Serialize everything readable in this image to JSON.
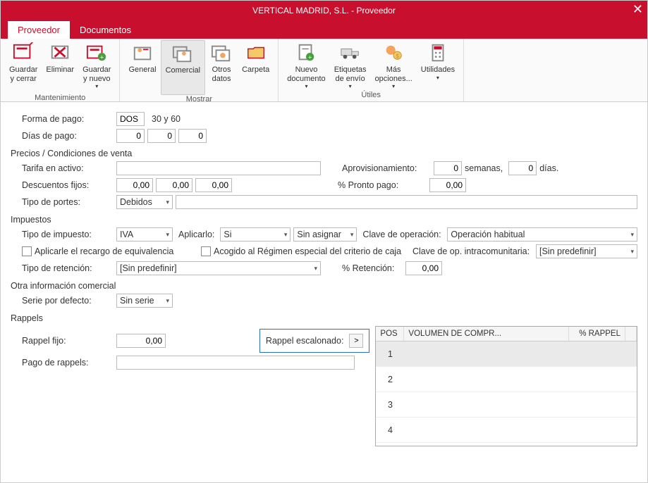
{
  "title": "VERTICAL MADRID, S.L. - Proveedor",
  "tabs": {
    "proveedor": "Proveedor",
    "documentos": "Documentos"
  },
  "ribbon": {
    "mantenimiento": {
      "label": "Mantenimiento",
      "guardar_cerrar": "Guardar\ny cerrar",
      "eliminar": "Eliminar",
      "guardar_nuevo": "Guardar\ny nuevo"
    },
    "mostrar": {
      "label": "Mostrar",
      "general": "General",
      "comercial": "Comercial",
      "otros_datos": "Otros\ndatos",
      "carpeta": "Carpeta"
    },
    "utiles": {
      "label": "Útiles",
      "nuevo_doc": "Nuevo\ndocumento",
      "etiquetas": "Etiquetas\nde envío",
      "mas": "Más\nopciones...",
      "utilidades": "Utilidades"
    }
  },
  "forma_pago": {
    "label": "Forma de pago:",
    "code": "DOS",
    "desc": "30 y 60"
  },
  "dias_pago": {
    "label": "Días de pago:",
    "v1": "0",
    "v2": "0",
    "v3": "0"
  },
  "precios": {
    "title": "Precios / Condiciones de venta",
    "tarifa_label": "Tarifa en activo:",
    "aprov_label": "Aprovisionamiento:",
    "aprov_sem": "0",
    "sem_label": "semanas,",
    "aprov_dias": "0",
    "dias_label": "días.",
    "desc_label": "Descuentos fijos:",
    "d1": "0,00",
    "d2": "0,00",
    "d3": "0,00",
    "pronto_label": "% Pronto pago:",
    "pronto": "0,00",
    "portes_label": "Tipo de portes:",
    "portes": "Debidos"
  },
  "impuestos": {
    "title": "Impuestos",
    "tipo_label": "Tipo de impuesto:",
    "tipo": "IVA",
    "aplicarlo_label": "Aplicarlo:",
    "aplicarlo": "Si",
    "sin_asignar": "Sin asignar",
    "clave_op_label": "Clave de operación:",
    "clave_op": "Operación habitual",
    "recargo_label": "Aplicarle el recargo de equivalencia",
    "acogido_label": "Acogido al Régimen especial del criterio de caja",
    "clave_intra_label": "Clave de op. intracomunitaria:",
    "clave_intra": "[Sin predefinir]",
    "ret_label": "Tipo de retención:",
    "ret": "[Sin predefinir]",
    "pct_ret_label": "% Retención:",
    "pct_ret": "0,00"
  },
  "otra": {
    "title": "Otra información comercial",
    "serie_label": "Serie por defecto:",
    "serie": "Sin serie"
  },
  "rappels": {
    "title": "Rappels",
    "fijo_label": "Rappel fijo:",
    "fijo": "0,00",
    "esc_label": "Rappel escalonado:",
    "pago_label": "Pago de rappels:",
    "grid": {
      "h_pos": "POS",
      "h_vol": "VOLUMEN DE COMPR...",
      "h_rap": "% RAPPEL",
      "row1": "1",
      "row2": "2",
      "row3": "3",
      "row4": "4"
    }
  }
}
